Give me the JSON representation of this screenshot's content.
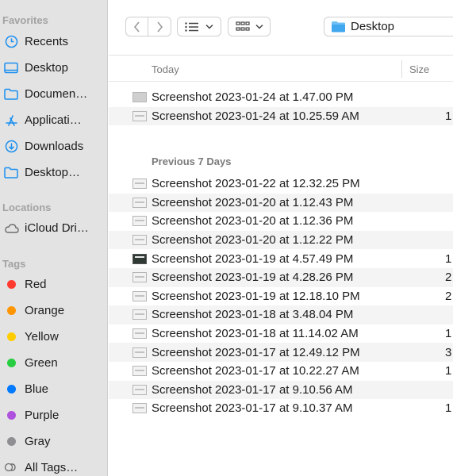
{
  "sidebar": {
    "favorites_header": "Favorites",
    "favorites": [
      {
        "label": "Recents",
        "icon": "clock-icon"
      },
      {
        "label": "Desktop",
        "icon": "desktop-icon"
      },
      {
        "label": "Documen…",
        "icon": "folder-icon"
      },
      {
        "label": "Applicati…",
        "icon": "applications-icon"
      },
      {
        "label": "Downloads",
        "icon": "download-icon"
      },
      {
        "label": "Desktop…",
        "icon": "folder-icon"
      }
    ],
    "locations_header": "Locations",
    "locations": [
      {
        "label": "iCloud Dri…",
        "icon": "cloud-icon"
      }
    ],
    "tags_header": "Tags",
    "tags": [
      {
        "label": "Red",
        "color": "#ff3b30"
      },
      {
        "label": "Orange",
        "color": "#ff9500"
      },
      {
        "label": "Yellow",
        "color": "#ffcc00"
      },
      {
        "label": "Green",
        "color": "#28cd41"
      },
      {
        "label": "Blue",
        "color": "#007aff"
      },
      {
        "label": "Purple",
        "color": "#af52de"
      },
      {
        "label": "Gray",
        "color": "#8e8e93"
      }
    ],
    "all_tags": "All Tags…"
  },
  "toolbar": {
    "location": "Desktop",
    "accent": "#1b8ff0"
  },
  "columns": {
    "name_group": "Today",
    "size": "Size"
  },
  "sections": [
    {
      "label": "Today",
      "files": [
        {
          "name": "Screenshot 2023-01-24 at 1.47.00 PM",
          "size": "",
          "thumb": "grey"
        },
        {
          "name": "Screenshot 2023-01-24 at 10.25.59 AM",
          "size": "1",
          "thumb": "light"
        }
      ]
    },
    {
      "label": "Previous 7 Days",
      "files": [
        {
          "name": "Screenshot 2023-01-22 at 12.32.25 PM",
          "size": "",
          "thumb": "light"
        },
        {
          "name": "Screenshot 2023-01-20 at 1.12.43 PM",
          "size": "",
          "thumb": "light"
        },
        {
          "name": "Screenshot 2023-01-20 at 1.12.36 PM",
          "size": "",
          "thumb": "light"
        },
        {
          "name": "Screenshot 2023-01-20 at 1.12.22 PM",
          "size": "",
          "thumb": "light"
        },
        {
          "name": "Screenshot 2023-01-19 at 4.57.49 PM",
          "size": "1",
          "thumb": "dark"
        },
        {
          "name": "Screenshot 2023-01-19 at 4.28.26 PM",
          "size": "2",
          "thumb": "light"
        },
        {
          "name": "Screenshot 2023-01-19 at 12.18.10 PM",
          "size": "2",
          "thumb": "light"
        },
        {
          "name": "Screenshot 2023-01-18 at 3.48.04 PM",
          "size": "",
          "thumb": "light"
        },
        {
          "name": "Screenshot 2023-01-18 at 11.14.02 AM",
          "size": "1",
          "thumb": "light"
        },
        {
          "name": "Screenshot 2023-01-17 at 12.49.12 PM",
          "size": "3",
          "thumb": "light"
        },
        {
          "name": "Screenshot 2023-01-17 at 10.22.27 AM",
          "size": "1",
          "thumb": "light"
        },
        {
          "name": "Screenshot 2023-01-17 at 9.10.56 AM",
          "size": "",
          "thumb": "light"
        },
        {
          "name": "Screenshot 2023-01-17 at 9.10.37 AM",
          "size": "1",
          "thumb": "light"
        }
      ]
    }
  ]
}
